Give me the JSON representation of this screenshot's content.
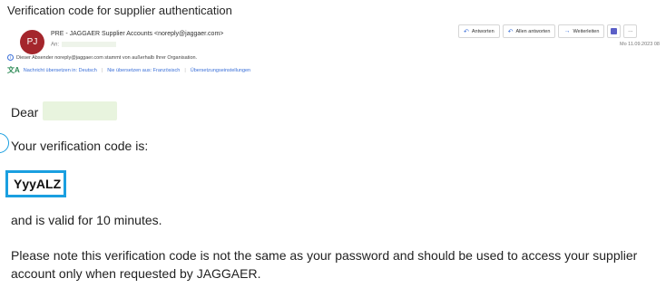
{
  "email": {
    "subject": "Verification code for supplier authentication",
    "avatar_initials": "PJ",
    "sender": "PRE - JAGGAER Supplier Accounts <noreply@jaggaer.com>",
    "to_label": "An:",
    "date": "Mo 11.09.2023 08",
    "external_warning": "Dieser Absender noreply@jaggaer.com stammt von außerhalb Ihrer Organisation.",
    "translate_bar": {
      "translate_to": "Nachricht übersetzen in: Deutsch",
      "never_translate": "Nie übersetzen aus: Französisch",
      "settings": "Übersetzungseinstellungen"
    },
    "actions": {
      "reply": "Antworten",
      "reply_all": "Allen antworten",
      "forward": "Weiterleiten",
      "more": "···"
    },
    "body": {
      "greeting": "Dear",
      "intro": "Your verification code is:",
      "code": "YyyALZ",
      "validity": "and is valid for 10 minutes.",
      "note": "Please note this verification code is not the same as your password and should be used to access your supplier account only when requested by JAGGAER."
    }
  },
  "colors": {
    "avatar": "#a4262c",
    "highlight_border": "#1a9fe0",
    "link": "#3a6fd8",
    "redaction": "#e8f4de"
  }
}
